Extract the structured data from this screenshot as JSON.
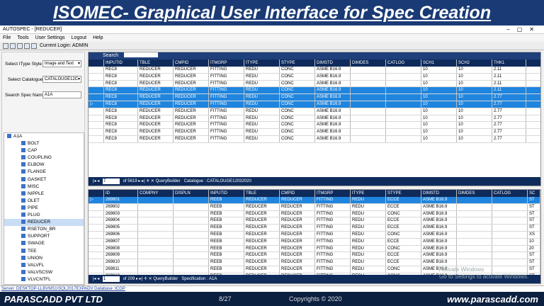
{
  "slide": {
    "title": "ISOMEC- Graphical User Interface for Spec Creation"
  },
  "window": {
    "title": "AUTOSPEC - [REDUCER]"
  },
  "menu": [
    "File",
    "Tools",
    "User Settings",
    "Logout",
    "Help"
  ],
  "toolbar": {
    "login": "Current Login: ADMIN"
  },
  "left": {
    "itype_label": "Select IType Style",
    "itype_value": "Image and Text",
    "catalogue_label": "Select Catalogue",
    "catalogue_value": "CATALOUGE12C",
    "spec_label": "Search Spec Name:",
    "spec_value": "A1A",
    "tree_root": "A1A",
    "tree_items": [
      "BOLT",
      "CAP",
      "COUPLING",
      "ELBOW",
      "FLANGE",
      "GASKET",
      "MISC",
      "NIPPLE",
      "OLET",
      "PIPE",
      "PLUG",
      "REDUCER",
      "RSETON_BR",
      "SUPPORT",
      "SWAGE",
      "TEE",
      "UNION",
      "VALVFL",
      "VALVSCSW",
      "VLVCNTFL"
    ]
  },
  "top_grid": {
    "search_label": "Search",
    "columns": [
      "INPUTID",
      "TBLE",
      "CMPID",
      "ITMGRP",
      "ITYPE",
      "STYPE",
      "DIMSTD",
      "DIMDES",
      "CATLOG",
      "SCH1",
      "SCH2",
      "THK1"
    ],
    "rows": [
      [
        "REC8",
        "REDUCER",
        "REDUCER",
        "FITTING",
        "REDU",
        "CONC",
        "ASME B16.9",
        "",
        "",
        "10",
        "10",
        "2.11"
      ],
      [
        "REC8",
        "REDUCER",
        "REDUCER",
        "FITTING",
        "REDU",
        "CONC",
        "ASME B16.9",
        "",
        "",
        "10",
        "10",
        "2.11"
      ],
      [
        "REC8",
        "REDUCER",
        "REDUCER",
        "FITTING",
        "REDU",
        "CONC",
        "ASME B16.9",
        "",
        "",
        "10",
        "10",
        "2.11"
      ],
      [
        "REC8",
        "REDUCER",
        "REDUCER",
        "FITTING",
        "REDU",
        "CONC",
        "ASME B16.9",
        "",
        "",
        "10",
        "10",
        "2.11"
      ],
      [
        "REC8",
        "REDUCER",
        "REDUCER",
        "FITTING",
        "REDU",
        "CONC",
        "ASME B16.9",
        "",
        "",
        "10",
        "10",
        "2.77"
      ],
      [
        "REC8",
        "REDUCER",
        "REDUCER",
        "FITTING",
        "REDU",
        "CONC",
        "ASME B16.9",
        "",
        "",
        "10",
        "10",
        "2.77"
      ],
      [
        "REC8",
        "REDUCER",
        "REDUCER",
        "FITTING",
        "REDU",
        "CONC",
        "ASME B16.9",
        "",
        "",
        "10",
        "10",
        "2.77"
      ],
      [
        "REC8",
        "REDUCER",
        "REDUCER",
        "FITTING",
        "REDU",
        "CONC",
        "ASME B16.9",
        "",
        "",
        "10",
        "10",
        "2.77"
      ],
      [
        "REC8",
        "REDUCER",
        "REDUCER",
        "FITTING",
        "REDU",
        "CONC",
        "ASME B16.9",
        "",
        "",
        "10",
        "10",
        "2.77"
      ],
      [
        "REC8",
        "REDUCER",
        "REDUCER",
        "FITTING",
        "REDU",
        "CONC",
        "ASME B16.9",
        "",
        "",
        "10",
        "10",
        "2.77"
      ],
      [
        "REC8",
        "REDUCER",
        "REDUCER",
        "FITTING",
        "REDU",
        "CONC",
        "ASME B16.9",
        "",
        "",
        "10",
        "10",
        "2.77"
      ]
    ],
    "nav": {
      "page": "7",
      "of": "of 5619",
      "query": "QueryBuilder",
      "info": "Catalogue : CATALOUGE12032020"
    }
  },
  "bottom_grid": {
    "columns": [
      "ID",
      "COMPNY",
      "DISPLN",
      "INPUTID",
      "TBLE",
      "CMPID",
      "ITMGRP",
      "ITYPE",
      "STYPE",
      "DIMSTD",
      "DIMDES",
      "CATLOG",
      "SC"
    ],
    "rows": [
      [
        "269801",
        "",
        "",
        "REEB",
        "REDUCER",
        "REDUCER",
        "FITTING",
        "REDU",
        "ECCE",
        "ASME B16.9",
        "",
        "",
        "ST"
      ],
      [
        "269802",
        "",
        "",
        "REEB",
        "REDUCER",
        "REDUCER",
        "FITTING",
        "REDU",
        "ECCE",
        "ASME B16.9",
        "",
        "",
        "ST"
      ],
      [
        "269803",
        "",
        "",
        "REEB",
        "REDUCER",
        "REDUCER",
        "FITTING",
        "REDU",
        "CONC",
        "ASME B16.9",
        "",
        "",
        "ST"
      ],
      [
        "269804",
        "",
        "",
        "REEB",
        "REDUCER",
        "REDUCER",
        "FITTING",
        "REDU",
        "ECCE",
        "ASME B16.9",
        "",
        "",
        "ST"
      ],
      [
        "269805",
        "",
        "",
        "REEB",
        "REDUCER",
        "REDUCER",
        "FITTING",
        "REDU",
        "ECCE",
        "ASME B16.9",
        "",
        "",
        "ST"
      ],
      [
        "269806",
        "",
        "",
        "REEB",
        "REDUCER",
        "REDUCER",
        "FITTING",
        "REDU",
        "CONC",
        "ASME B16.9",
        "",
        "",
        "XS"
      ],
      [
        "269807",
        "",
        "",
        "REEB",
        "REDUCER",
        "REDUCER",
        "FITTING",
        "REDU",
        "ECCE",
        "ASME B16.9",
        "",
        "",
        "10"
      ],
      [
        "269808",
        "",
        "",
        "REEB",
        "REDUCER",
        "REDUCER",
        "FITTING",
        "REDU",
        "CONC",
        "ASME B16.9",
        "",
        "",
        "20"
      ],
      [
        "269809",
        "",
        "",
        "REEB",
        "REDUCER",
        "REDUCER",
        "FITTING",
        "REDU",
        "ECCE",
        "ASME B16.9",
        "",
        "",
        "ST"
      ],
      [
        "269810",
        "",
        "",
        "REEB",
        "REDUCER",
        "REDUCER",
        "FITTING",
        "REDU",
        "ECCE",
        "ASME B16.9",
        "",
        "",
        "ST"
      ],
      [
        "269811",
        "",
        "",
        "REEB",
        "REDUCER",
        "REDUCER",
        "FITTING",
        "REDU",
        "CONC",
        "ASME B16.9",
        "",
        "",
        "ST"
      ],
      [
        "269812",
        "",
        "",
        "REEB",
        "REDUCER",
        "REDUCER",
        "FITTING",
        "REDU",
        "CONC",
        "ASME B16.9",
        "",
        "",
        "ST"
      ],
      [
        "269813",
        "",
        "",
        "REEB",
        "REDUCER",
        "REDUCER",
        "FITTING",
        "REDU",
        "ECCE",
        "ASME B16.9",
        "",
        "",
        "XS"
      ]
    ],
    "nav": {
      "page": "1",
      "of": "of 209",
      "query": "QueryBuilder",
      "info": "Specification : A1A"
    }
  },
  "status": {
    "label": "Server :",
    "value": "DESKTOP-LLBVMS1\\SQL2017EXPADV Database :ICGP"
  },
  "watermark": {
    "line1": "Activate Windows",
    "line2": "Go to Settings to activate Windows."
  },
  "footer": {
    "left": "PARASCADD PVT LTD",
    "page": "8/27",
    "copyright": "Copyrights © 2020",
    "website": "www.parascadd.com"
  },
  "colors": {
    "header": "#1a3a75",
    "grid_header": "#0e2b5c",
    "row_highlight": "#1f85de"
  }
}
